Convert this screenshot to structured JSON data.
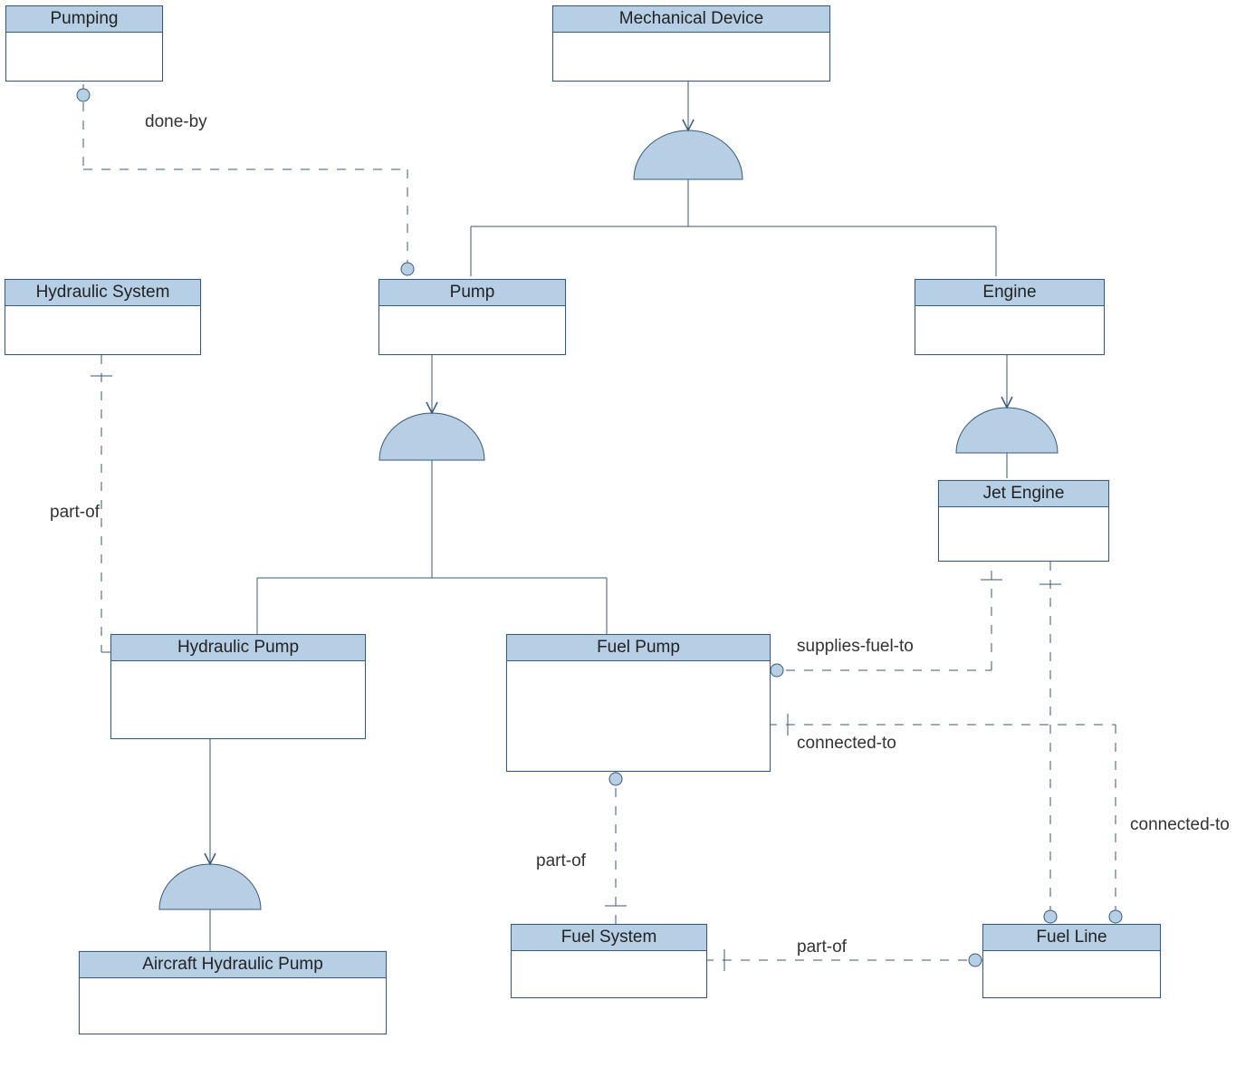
{
  "entities": {
    "pumping": "Pumping",
    "mechDevice": "Mechanical Device",
    "hydraulicSystem": "Hydraulic System",
    "pump": "Pump",
    "engine": "Engine",
    "jetEngine": "Jet Engine",
    "hydraulicPump": "Hydraulic Pump",
    "fuelPump": "Fuel Pump",
    "aircraftHydraulicPump": "Aircraft Hydraulic Pump",
    "fuelSystem": "Fuel System",
    "fuelLine": "Fuel Line"
  },
  "relations": {
    "doneBy": "done-by",
    "partOf1": "part-of",
    "suppliesFuelTo": "supplies-fuel-to",
    "connectedTo1": "connected-to",
    "connectedTo2": "connected-to",
    "partOf2": "part-of",
    "partOf3": "part-of"
  }
}
